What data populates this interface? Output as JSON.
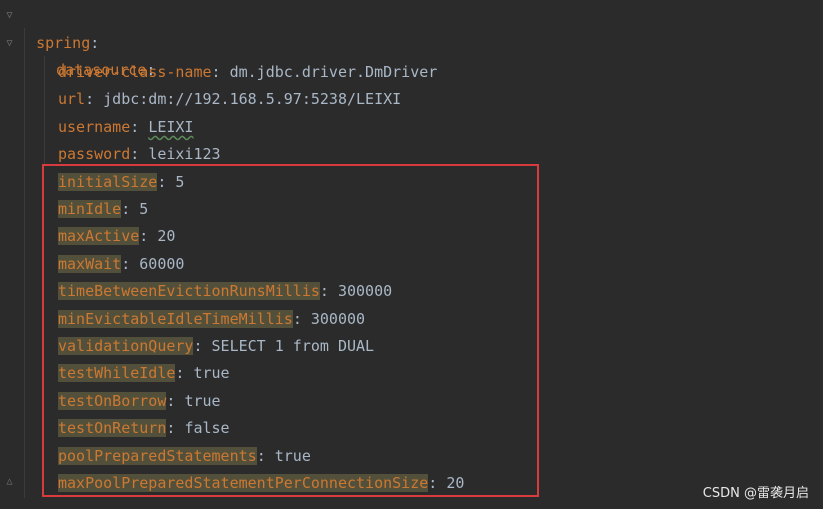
{
  "editor": {
    "root_key": "spring",
    "section_key": "datasource",
    "lines": [
      {
        "key": "driver-class-name",
        "value": "dm.jdbc.driver.DmDriver"
      },
      {
        "key": "url",
        "value": "jdbc:dm://192.168.5.97:5238/LEIXI"
      },
      {
        "key": "username",
        "value": "LEIXI"
      },
      {
        "key": "password",
        "value": "leixi123"
      },
      {
        "key": "initialSize",
        "value": "5"
      },
      {
        "key": "minIdle",
        "value": "5"
      },
      {
        "key": "maxActive",
        "value": "20"
      },
      {
        "key": "maxWait",
        "value": "60000"
      },
      {
        "key": "timeBetweenEvictionRunsMillis",
        "value": "300000"
      },
      {
        "key": "minEvictableIdleTimeMillis",
        "value": "300000"
      },
      {
        "key": "validationQuery",
        "value": "SELECT 1 from DUAL"
      },
      {
        "key": "testWhileIdle",
        "value": "true"
      },
      {
        "key": "testOnBorrow",
        "value": "true"
      },
      {
        "key": "testOnReturn",
        "value": "false"
      },
      {
        "key": "poolPreparedStatements",
        "value": "true"
      },
      {
        "key": "maxPoolPreparedStatementPerConnectionSize",
        "value": "20"
      }
    ],
    "colors": {
      "background": "#2b2b2b",
      "key": "#cc7832",
      "value": "#a9b7c6",
      "highlight": "#52503a",
      "selection_border": "#d73b3e"
    }
  },
  "watermark": "CSDN @雷袭月启"
}
